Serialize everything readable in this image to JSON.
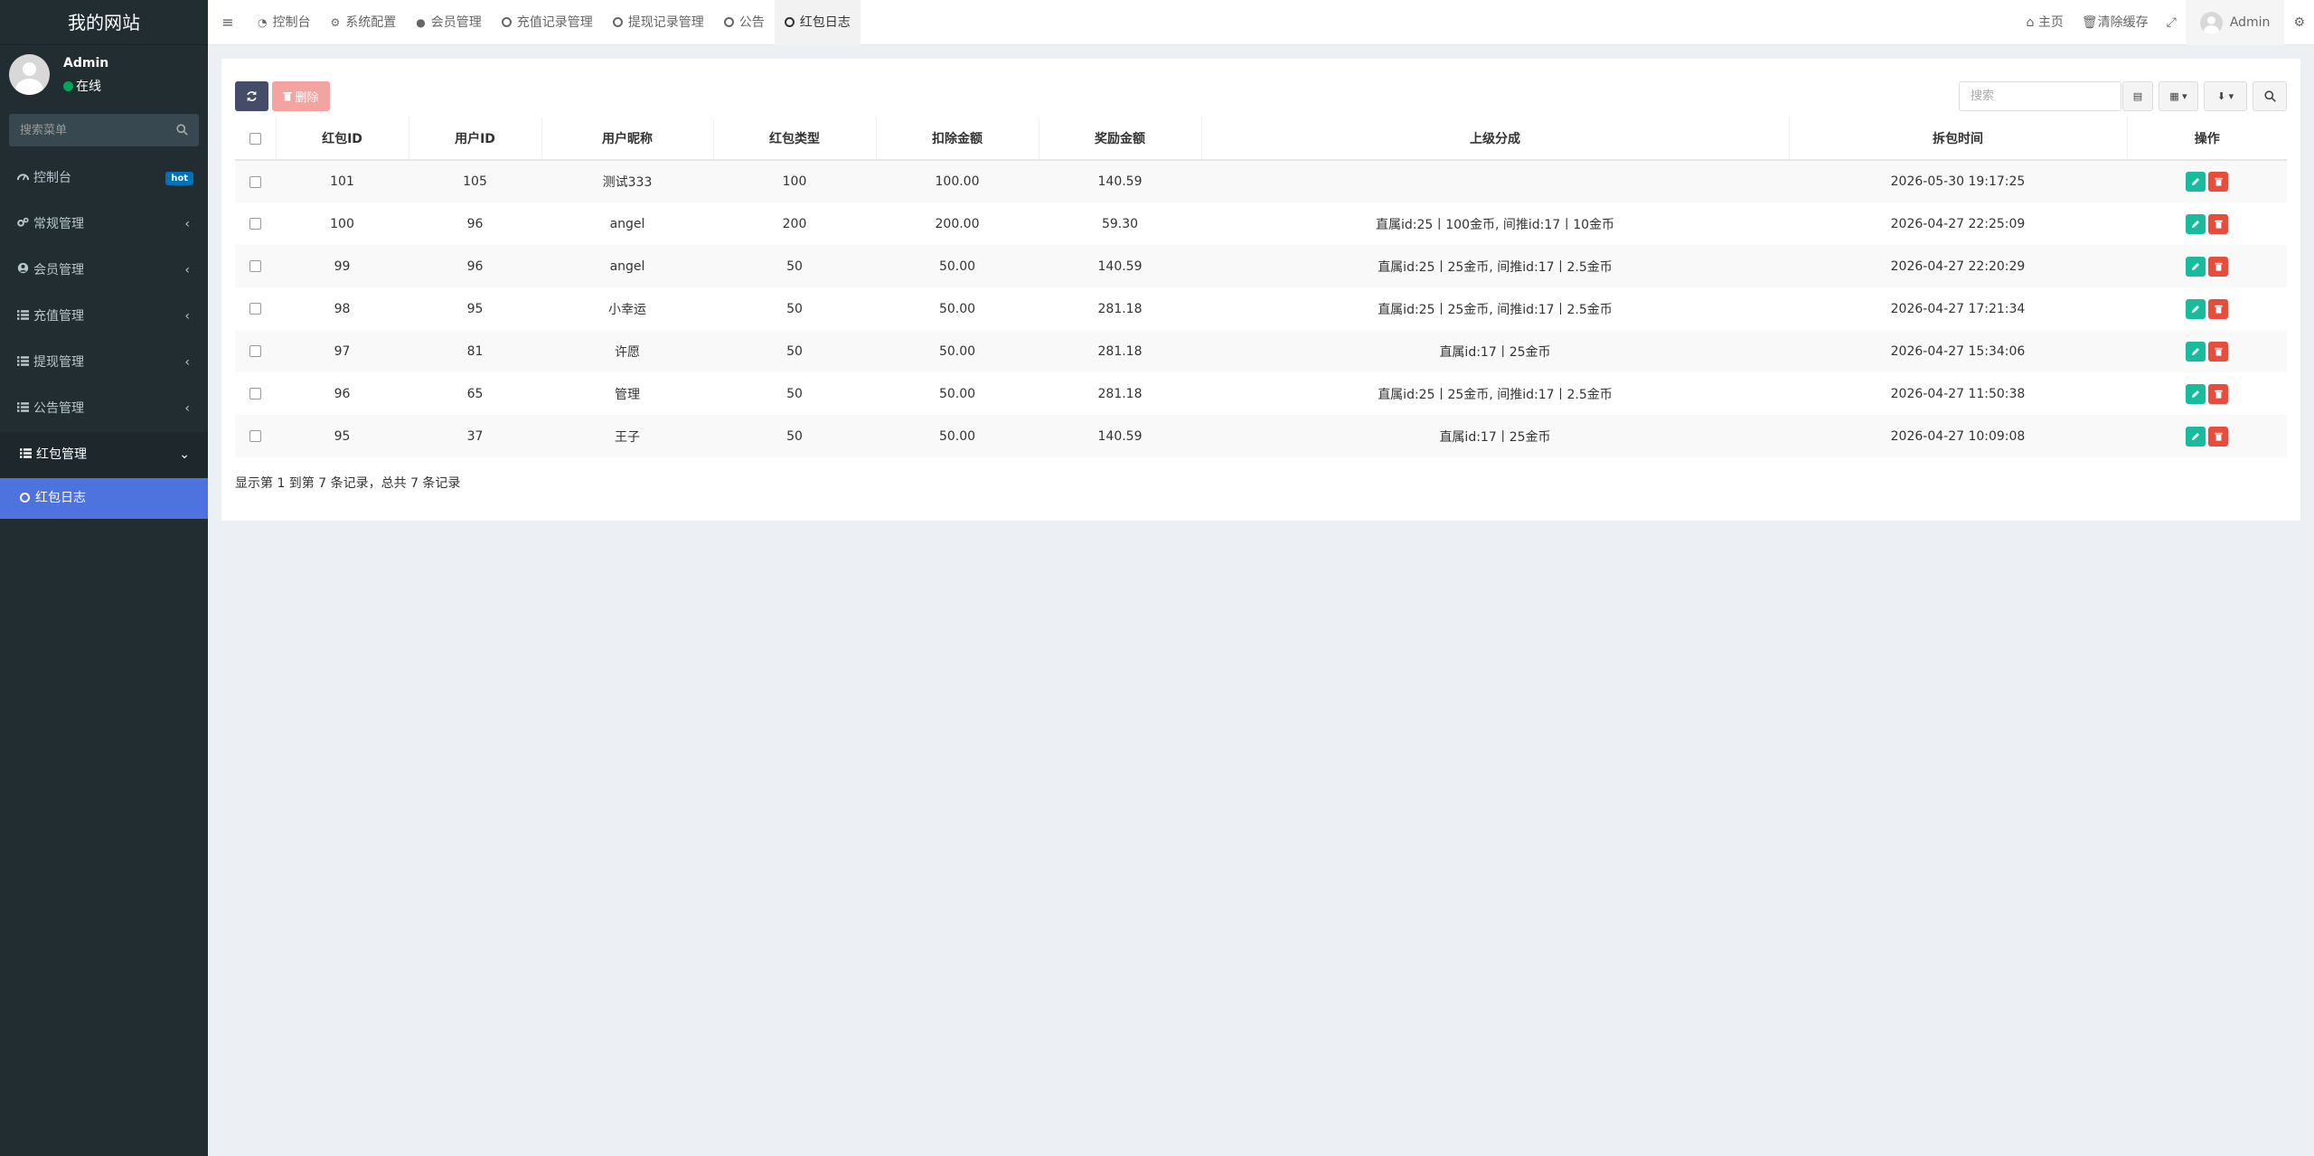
{
  "site": {
    "title": "我的网站"
  },
  "user": {
    "name": "Admin",
    "status": "在线"
  },
  "sidebar": {
    "search_placeholder": "搜索菜单",
    "hot_badge": "hot",
    "menu": [
      {
        "label": "控制台",
        "icon": "dashboard-icon"
      },
      {
        "label": "常规管理",
        "icon": "cogs-icon"
      },
      {
        "label": "会员管理",
        "icon": "user-circle-icon"
      },
      {
        "label": "充值管理",
        "icon": "list-icon"
      },
      {
        "label": "提现管理",
        "icon": "list-icon"
      },
      {
        "label": "公告管理",
        "icon": "list-icon"
      },
      {
        "label": "红包管理",
        "icon": "list-icon"
      }
    ],
    "submenu": {
      "label": "红包日志",
      "icon": "circle-o-icon"
    }
  },
  "topbar": {
    "tabs": [
      {
        "label": "控制台",
        "icon": "dashboard-icon"
      },
      {
        "label": "系统配置",
        "icon": "gear-icon"
      },
      {
        "label": "会员管理",
        "icon": "user-icon"
      },
      {
        "label": "充值记录管理",
        "icon": "circle-o-icon"
      },
      {
        "label": "提现记录管理",
        "icon": "circle-o-icon"
      },
      {
        "label": "公告",
        "icon": "circle-o-icon"
      },
      {
        "label": "红包日志",
        "icon": "circle-o-icon"
      }
    ],
    "home_label": "主页",
    "clear_cache_label": "清除缓存",
    "user_name": "Admin"
  },
  "toolbar": {
    "delete_label": "删除",
    "search_placeholder": "搜索"
  },
  "table": {
    "columns": [
      "红包ID",
      "用户ID",
      "用户昵称",
      "红包类型",
      "扣除金额",
      "奖励金额",
      "上级分成",
      "拆包时间",
      "操作"
    ],
    "rows": [
      [
        "101",
        "105",
        "测试333",
        "100",
        "100.00",
        "140.59",
        "",
        "2026-05-30 19:17:25"
      ],
      [
        "100",
        "96",
        "angel",
        "200",
        "200.00",
        "59.30",
        "直属id:25丨100金币, 间推id:17丨10金币",
        "2026-04-27 22:25:09"
      ],
      [
        "99",
        "96",
        "angel",
        "50",
        "50.00",
        "140.59",
        "直属id:25丨25金币, 间推id:17丨2.5金币",
        "2026-04-27 22:20:29"
      ],
      [
        "98",
        "95",
        "小幸运",
        "50",
        "50.00",
        "281.18",
        "直属id:25丨25金币, 间推id:17丨2.5金币",
        "2026-04-27 17:21:34"
      ],
      [
        "97",
        "81",
        "许愿",
        "50",
        "50.00",
        "281.18",
        "直属id:17丨25金币",
        "2026-04-27 15:34:06"
      ],
      [
        "96",
        "65",
        "管理",
        "50",
        "50.00",
        "281.18",
        "直属id:25丨25金币, 间推id:17丨2.5金币",
        "2026-04-27 11:50:38"
      ],
      [
        "95",
        "37",
        "王子",
        "50",
        "50.00",
        "140.59",
        "直属id:17丨25金币",
        "2026-04-27 10:09:08"
      ]
    ],
    "summary": "显示第 1 到第 7 条记录，总共 7 条记录"
  },
  "colors": {
    "sidebar_bg": "#222d32",
    "active_sub": "#4e73df",
    "edit": "#18bc9c",
    "delete": "#e74c3c",
    "refresh": "#444c69"
  }
}
